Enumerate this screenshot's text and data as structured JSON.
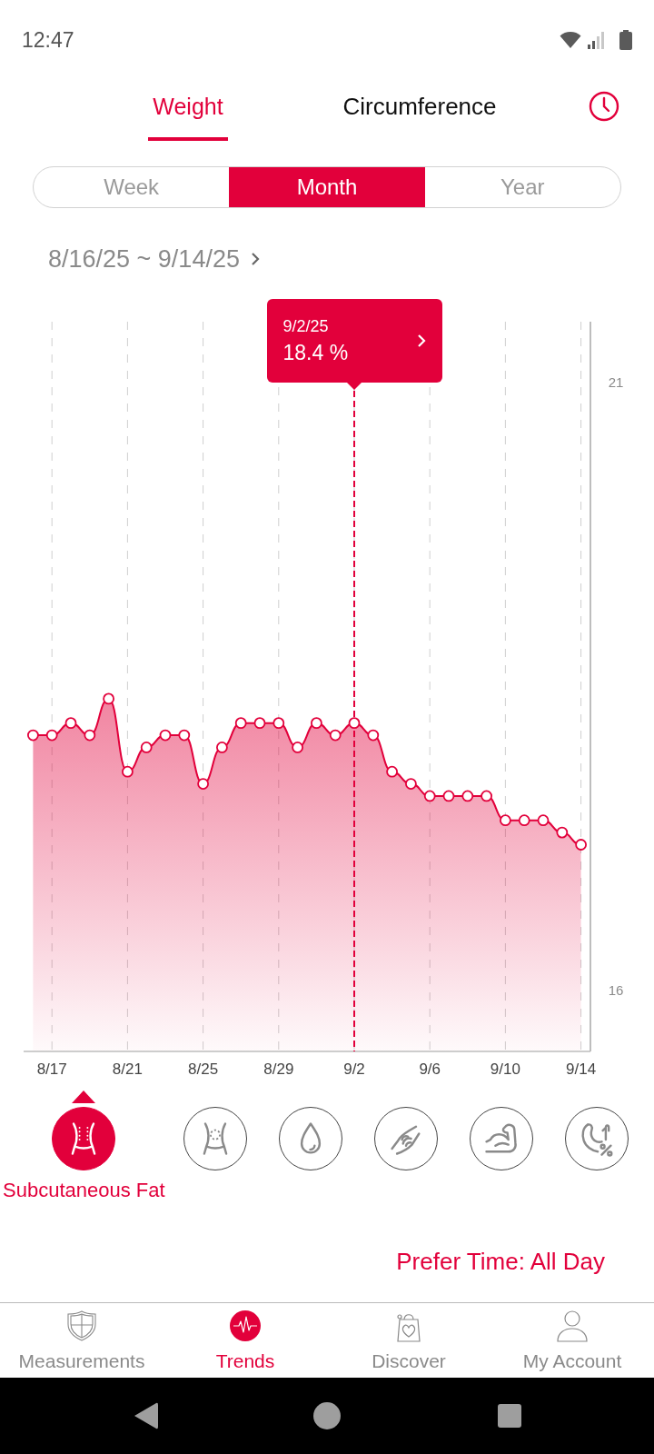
{
  "status_bar": {
    "time": "12:47"
  },
  "tabs": [
    {
      "label": "Weight",
      "selected": true
    },
    {
      "label": "Circumference",
      "selected": false
    }
  ],
  "periods": [
    {
      "label": "Week",
      "selected": false
    },
    {
      "label": "Month",
      "selected": true
    },
    {
      "label": "Year",
      "selected": false
    }
  ],
  "date_range": "8/16/25 ~ 9/14/25",
  "trend": {
    "chart_data": {
      "type": "area",
      "categories": [
        null,
        "8/17",
        null,
        null,
        null,
        "8/21",
        null,
        null,
        null,
        "8/25",
        null,
        null,
        null,
        "8/29",
        null,
        null,
        null,
        "9/2",
        null,
        null,
        null,
        "9/6",
        null,
        null,
        null,
        "9/10",
        null,
        null,
        null,
        "9/14"
      ],
      "series": [
        {
          "color": "#e2003b",
          "values": [
            18.1,
            18.1,
            18.2,
            18.1,
            18.4,
            17.8,
            18.0,
            18.1,
            18.1,
            17.7,
            18.0,
            18.2,
            18.2,
            18.2,
            18.0,
            18.2,
            18.1,
            18.2,
            18.1,
            17.8,
            17.7,
            17.6,
            17.6,
            17.6,
            17.6,
            17.4,
            17.4,
            17.4,
            17.3,
            17.2
          ]
        }
      ],
      "ylim": [
        15.5,
        21.5
      ],
      "yticks": [
        16,
        21
      ],
      "grid": true,
      "ref_lines": [
        {
          "axis": "x",
          "value": "9/2"
        }
      ],
      "annotations": [
        "9/2/25",
        "18.4 %"
      ]
    }
  },
  "metrics": [
    {
      "label": "Subcutaneous Fat",
      "selected": true
    },
    {
      "selected": false
    },
    {
      "selected": false
    },
    {
      "selected": false
    },
    {
      "selected": false
    },
    {
      "selected": false
    }
  ],
  "prefer_time": "Prefer Time: All Day",
  "nav": [
    {
      "label": "Measurements",
      "selected": false
    },
    {
      "label": "Trends",
      "selected": true
    },
    {
      "label": "Discover",
      "selected": false
    },
    {
      "label": "My Account",
      "selected": false
    }
  ]
}
